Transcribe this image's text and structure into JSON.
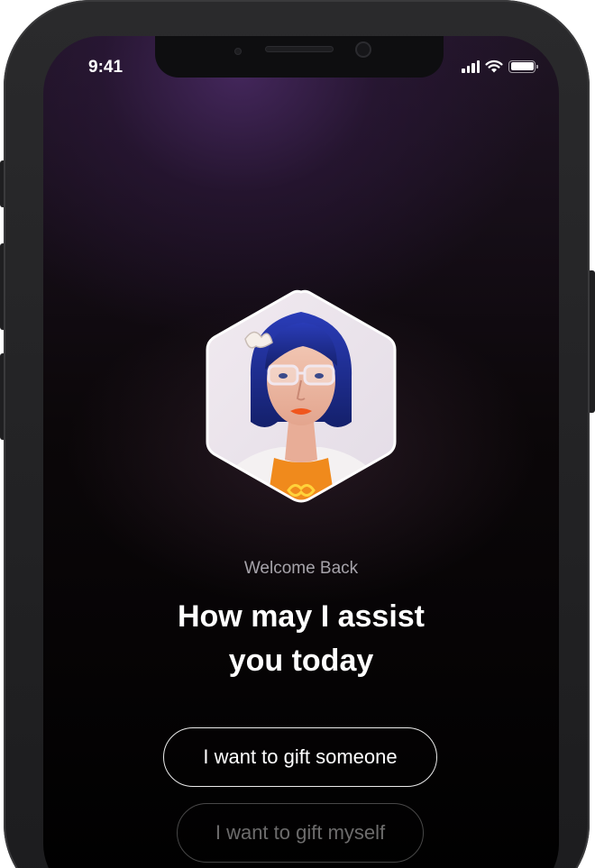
{
  "status_bar": {
    "time": "9:41",
    "icons": [
      "signal-icon",
      "wifi-icon",
      "battery-icon"
    ]
  },
  "assistant": {
    "avatar": "assistant-avatar-portrait",
    "welcome_text": "Welcome Back",
    "headline_line1": "How may I assist",
    "headline_line2": "you today"
  },
  "options": [
    {
      "label": "I want to gift someone"
    },
    {
      "label": "I want to gift myself"
    }
  ],
  "colors": {
    "background": "#000000",
    "glow": "#462a5f",
    "text_primary": "#ffffff",
    "text_muted": "#a6a3aa",
    "shirt": "#f08a1c",
    "hair": "#1c2a8f"
  }
}
